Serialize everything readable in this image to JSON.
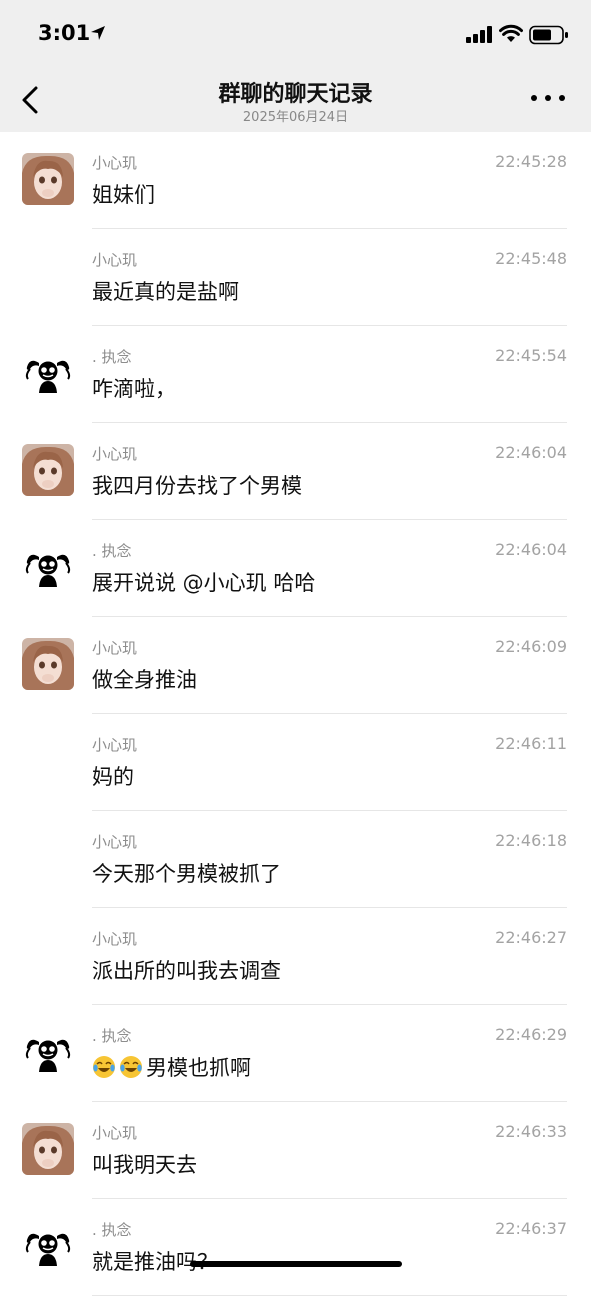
{
  "status": {
    "time": "3:01"
  },
  "header": {
    "title": "群聊的聊天记录",
    "date": "2025年06月24日"
  },
  "icons": {
    "back": "chevron-left-icon",
    "more": "more-dots-icon",
    "emoji": "face-with-tears-of-joy"
  },
  "messages": [
    {
      "sender": "小心玑",
      "time": "22:45:28",
      "text": "姐妹们",
      "avatar": "girl"
    },
    {
      "sender": "小心玑",
      "time": "22:45:48",
      "text": "最近真的是盐啊",
      "avatar": ""
    },
    {
      "sender": ". 执念",
      "time": "22:45:54",
      "text": "咋滴啦，",
      "avatar": "cartoon"
    },
    {
      "sender": "小心玑",
      "time": "22:46:04",
      "text": "我四月份去找了个男模",
      "avatar": "girl"
    },
    {
      "sender": ". 执念",
      "time": "22:46:04",
      "text": "展开说说 @小心玑  哈哈",
      "avatar": "cartoon"
    },
    {
      "sender": "小心玑",
      "time": "22:46:09",
      "text": "做全身推油",
      "avatar": "girl"
    },
    {
      "sender": "小心玑",
      "time": "22:46:11",
      "text": "妈的",
      "avatar": ""
    },
    {
      "sender": "小心玑",
      "time": "22:46:18",
      "text": "今天那个男模被抓了",
      "avatar": ""
    },
    {
      "sender": "小心玑",
      "time": "22:46:27",
      "text": "派出所的叫我去调查",
      "avatar": ""
    },
    {
      "sender": ". 执念",
      "time": "22:46:29",
      "text": "男模也抓啊",
      "emoji_count": 2,
      "avatar": "cartoon"
    },
    {
      "sender": "小心玑",
      "time": "22:46:33",
      "text": "叫我明天去",
      "avatar": "girl"
    },
    {
      "sender": ". 执念",
      "time": "22:46:37",
      "text": "就是推油吗？",
      "avatar": "cartoon"
    }
  ],
  "colors": {
    "header_bg": "#efefef",
    "sender": "#8d8d8d",
    "timestamp": "#a3a3a3",
    "divider": "#e6e6e6",
    "text": "#111111"
  }
}
